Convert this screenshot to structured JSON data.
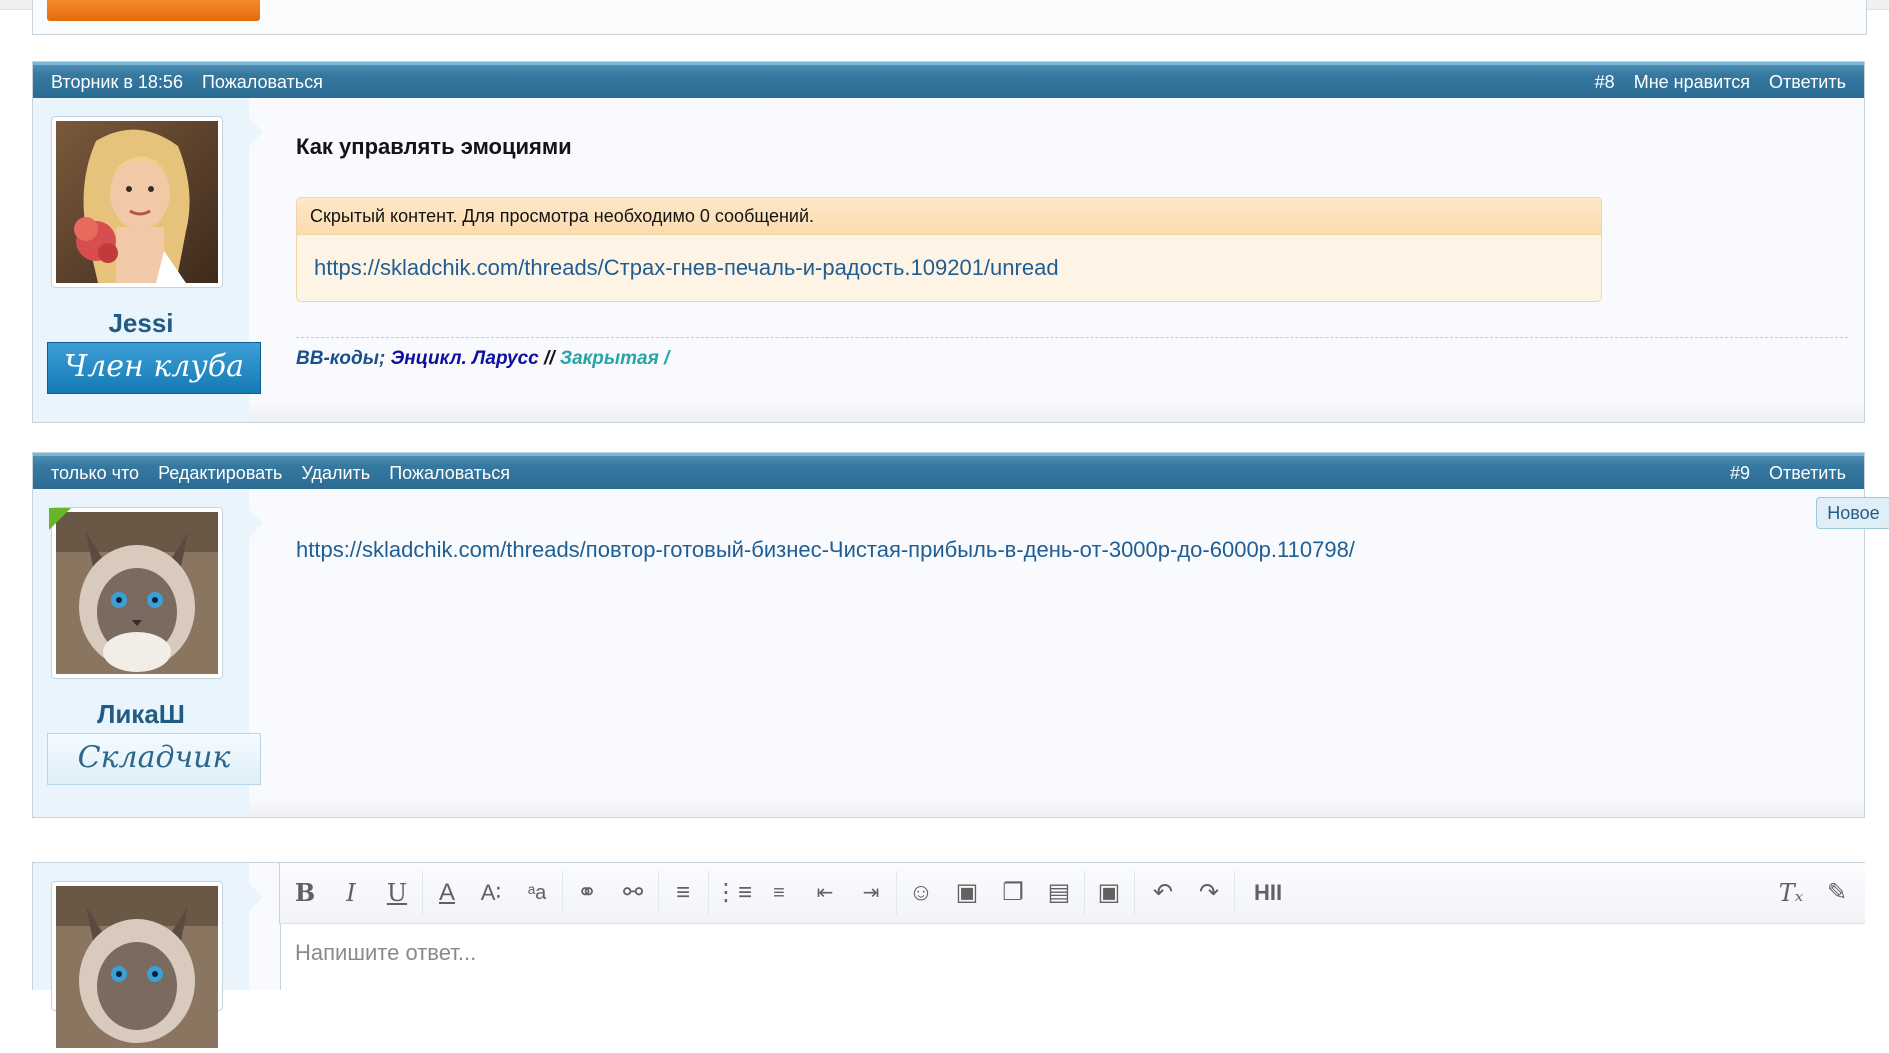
{
  "posts": [
    {
      "header_left": [
        "Вторник в 18:56",
        "Пожаловаться"
      ],
      "header_right": [
        "#8",
        "Мне нравится",
        "Ответить"
      ],
      "username": "Jessi",
      "rank": "Член клуба",
      "title": "Как управлять эмоциями",
      "hidden_notice": "Скрытый контент. Для просмотра необходимо 0 сообщений.",
      "hidden_link": "https://skladchik.com/threads/Страх-гнев-печаль-и-радость.109201/unread",
      "signature": {
        "part1": "BB-коды;",
        "part2": "Энцикл. Ларусс",
        "part3": "//",
        "part4": "Закрытая /"
      }
    },
    {
      "header_left": [
        "только что",
        "Редактировать",
        "Удалить",
        "Пожаловаться"
      ],
      "header_right": [
        "#9",
        "Ответить"
      ],
      "username": "ЛикаШ",
      "rank": "Складчик",
      "link": "https://skladchik.com/threads/повтор-готовый-бизнес-Чистая-прибыль-в-день-от-3000р-до-6000р.110798/",
      "badge": "Новое"
    }
  ],
  "editor": {
    "placeholder": "Напишите ответ...",
    "tools": [
      "bold-icon",
      "italic-icon",
      "underline-icon",
      "font-color-icon",
      "font-size-icon",
      "font-family-icon",
      "link-icon",
      "unlink-icon",
      "align-icon",
      "bullet-list-icon",
      "numbered-list-icon",
      "outdent-icon",
      "indent-icon",
      "smilie-icon",
      "image-icon",
      "media-icon",
      "quote-icon",
      "save-draft-icon",
      "undo-icon",
      "redo-icon",
      "hide-icon",
      "remove-format-icon",
      "toggle-bbcode-icon"
    ]
  },
  "colors": {
    "header_blue": "#2c6c93",
    "link_blue": "#1f5e94",
    "signature_navy": "#1a4f8a",
    "signature_teal": "#2aa4a4",
    "orange": "#e26b0d"
  }
}
